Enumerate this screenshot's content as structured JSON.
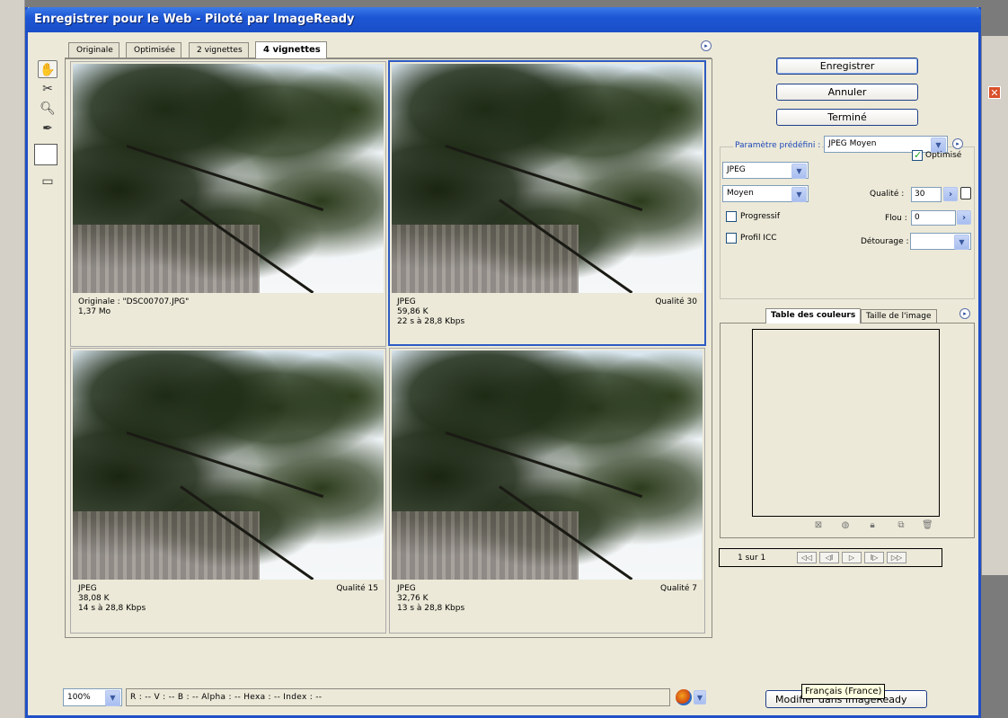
{
  "window": {
    "title": "Enregistrer pour le Web - Piloté par ImageReady"
  },
  "tabs": [
    {
      "label": "Originale"
    },
    {
      "label": "Optimisée"
    },
    {
      "label": "2 vignettes"
    },
    {
      "label": "4 vignettes",
      "active": true
    }
  ],
  "panels": [
    {
      "line1": "Originale : \"DSC00707.JPG\"",
      "line2": "1,37 Mo",
      "line3": "",
      "right": ""
    },
    {
      "line1": "JPEG",
      "line2": "59,86 K",
      "line3": "22 s à 28,8 Kbps",
      "right": "Qualité 30"
    },
    {
      "line1": "JPEG",
      "line2": "38,08 K",
      "line3": "14 s à 28,8 Kbps",
      "right": "Qualité 15"
    },
    {
      "line1": "JPEG",
      "line2": "32,76 K",
      "line3": "13 s à 28,8 Kbps",
      "right": "Qualité 7"
    }
  ],
  "buttons": {
    "save": "Enregistrer",
    "cancel": "Annuler",
    "done": "Terminé"
  },
  "settings": {
    "preset_label": "Paramètre prédéfini :",
    "preset_value": "JPEG  Moyen",
    "format": "JPEG",
    "quality_level": "Moyen",
    "optimized_label": "Optimisé",
    "optimized_checked": true,
    "quality_label": "Qualité :",
    "quality_value": "30",
    "progressive_label": "Progressif",
    "progressive_checked": false,
    "blur_label": "Flou :",
    "blur_value": "0",
    "icc_label": "Profil ICC",
    "icc_checked": false,
    "matte_label": "Détourage :",
    "matte_value": ""
  },
  "color_tabs": [
    {
      "label": "Table des couleurs",
      "active": true
    },
    {
      "label": "Taille de l'image"
    }
  ],
  "pager": {
    "label": "1 sur 1"
  },
  "status": {
    "zoom": "100%",
    "readout": "R :  --  V :  --  B :  --  Alpha :  -- Hexa :                   -- Index :  --"
  },
  "bottom": {
    "modify_button": "Modifier dans ImageReady",
    "tooltip": "Français (France)"
  },
  "colors": {
    "title_bar": "#1d56d4",
    "dialog_bg": "#ece9d8",
    "selection_border": "#2d5bc4"
  }
}
